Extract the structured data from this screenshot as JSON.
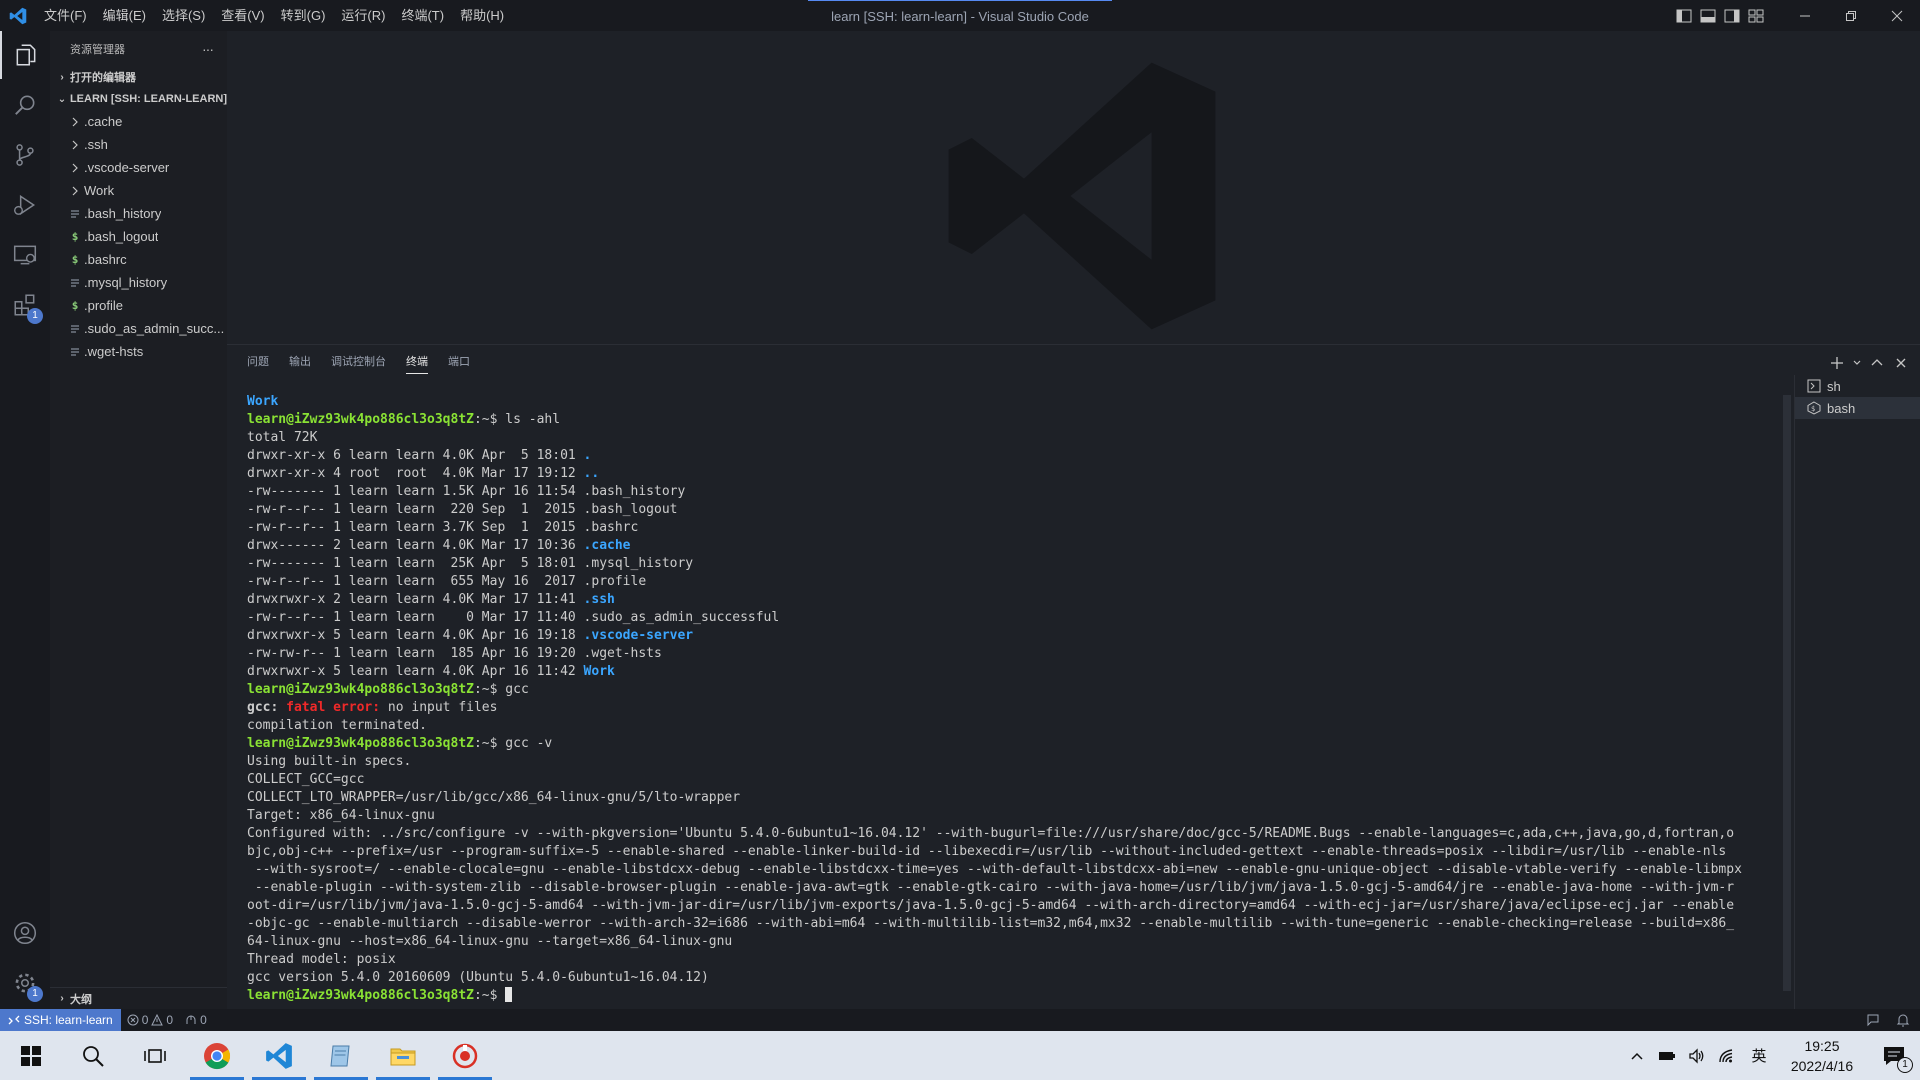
{
  "window": {
    "title": "learn [SSH: learn-learn] - Visual Studio Code",
    "menu": [
      "文件(F)",
      "编辑(E)",
      "选择(S)",
      "查看(V)",
      "转到(G)",
      "运行(R)",
      "终端(T)",
      "帮助(H)"
    ]
  },
  "activitybar": {
    "extensions_badge": "1",
    "settings_badge": "1"
  },
  "sidebar": {
    "title": "资源管理器",
    "more": "···",
    "open_editors": "打开的编辑器",
    "workspace": "LEARN [SSH: LEARN-LEARN]",
    "items": [
      {
        "label": ".cache",
        "kind": "folder"
      },
      {
        "label": ".ssh",
        "kind": "folder"
      },
      {
        "label": ".vscode-server",
        "kind": "folder"
      },
      {
        "label": "Work",
        "kind": "folder"
      },
      {
        "label": ".bash_history",
        "kind": "text"
      },
      {
        "label": ".bash_logout",
        "kind": "shell"
      },
      {
        "label": ".bashrc",
        "kind": "shell"
      },
      {
        "label": ".mysql_history",
        "kind": "text"
      },
      {
        "label": ".profile",
        "kind": "shell"
      },
      {
        "label": ".sudo_as_admin_succ...",
        "kind": "text"
      },
      {
        "label": ".wget-hsts",
        "kind": "text"
      }
    ],
    "outline": "大纲"
  },
  "panel": {
    "tabs": [
      "问题",
      "输出",
      "调试控制台",
      "终端",
      "端口"
    ],
    "active_tab": 3,
    "terminals": [
      "sh",
      "bash"
    ]
  },
  "terminal": {
    "prompt": "learn@iZwz93wk4po886cl3o3q8tZ",
    "lines": [
      [
        {
          "t": "Work",
          "c": "dir"
        }
      ],
      [
        {
          "t": "learn@iZwz93wk4po886cl3o3q8tZ",
          "c": "prompt"
        },
        {
          "t": ":~$ ls -ahl"
        }
      ],
      [
        {
          "t": "total 72K"
        }
      ],
      [
        {
          "t": "drwxr-xr-x 6 learn learn 4.0K Apr  5 18:01 "
        },
        {
          "t": ".",
          "c": "dir"
        }
      ],
      [
        {
          "t": "drwxr-xr-x 4 root  root  4.0K Mar 17 19:12 "
        },
        {
          "t": "..",
          "c": "dir"
        }
      ],
      [
        {
          "t": "-rw------- 1 learn learn 1.5K Apr 16 11:54 .bash_history"
        }
      ],
      [
        {
          "t": "-rw-r--r-- 1 learn learn  220 Sep  1  2015 .bash_logout"
        }
      ],
      [
        {
          "t": "-rw-r--r-- 1 learn learn 3.7K Sep  1  2015 .bashrc"
        }
      ],
      [
        {
          "t": "drwx------ 2 learn learn 4.0K Mar 17 10:36 "
        },
        {
          "t": ".cache",
          "c": "dir"
        }
      ],
      [
        {
          "t": "-rw------- 1 learn learn  25K Apr  5 18:01 .mysql_history"
        }
      ],
      [
        {
          "t": "-rw-r--r-- 1 learn learn  655 May 16  2017 .profile"
        }
      ],
      [
        {
          "t": "drwxrwxr-x 2 learn learn 4.0K Mar 17 11:41 "
        },
        {
          "t": ".ssh",
          "c": "dir"
        }
      ],
      [
        {
          "t": "-rw-r--r-- 1 learn learn    0 Mar 17 11:40 .sudo_as_admin_successful"
        }
      ],
      [
        {
          "t": "drwxrwxr-x 5 learn learn 4.0K Apr 16 19:18 "
        },
        {
          "t": ".vscode-server",
          "c": "dir"
        }
      ],
      [
        {
          "t": "-rw-rw-r-- 1 learn learn  185 Apr 16 19:20 .wget-hsts"
        }
      ],
      [
        {
          "t": "drwxrwxr-x 5 learn learn 4.0K Apr 16 11:42 "
        },
        {
          "t": "Work",
          "c": "dir"
        }
      ],
      [
        {
          "t": "learn@iZwz93wk4po886cl3o3q8tZ",
          "c": "prompt"
        },
        {
          "t": ":~$ gcc"
        }
      ],
      [
        {
          "t": "gcc: ",
          "c": "bold"
        },
        {
          "t": "fatal error: ",
          "c": "err"
        },
        {
          "t": "no input files"
        }
      ],
      [
        {
          "t": "compilation terminated."
        }
      ],
      [
        {
          "t": "learn@iZwz93wk4po886cl3o3q8tZ",
          "c": "prompt"
        },
        {
          "t": ":~$ gcc -v"
        }
      ],
      [
        {
          "t": "Using built-in specs."
        }
      ],
      [
        {
          "t": "COLLECT_GCC=gcc"
        }
      ],
      [
        {
          "t": "COLLECT_LTO_WRAPPER=/usr/lib/gcc/x86_64-linux-gnu/5/lto-wrapper"
        }
      ],
      [
        {
          "t": "Target: x86_64-linux-gnu"
        }
      ],
      [
        {
          "t": "Configured with: ../src/configure -v --with-pkgversion='Ubuntu 5.4.0-6ubuntu1~16.04.12' --with-bugurl=file:///usr/share/doc/gcc-5/README.Bugs --enable-languages=c,ada,c++,java,go,d,fortran,o"
        }
      ],
      [
        {
          "t": "bjc,obj-c++ --prefix=/usr --program-suffix=-5 --enable-shared --enable-linker-build-id --libexecdir=/usr/lib --without-included-gettext --enable-threads=posix --libdir=/usr/lib --enable-nls"
        }
      ],
      [
        {
          "t": " --with-sysroot=/ --enable-clocale=gnu --enable-libstdcxx-debug --enable-libstdcxx-time=yes --with-default-libstdcxx-abi=new --enable-gnu-unique-object --disable-vtable-verify --enable-libmpx"
        }
      ],
      [
        {
          "t": " --enable-plugin --with-system-zlib --disable-browser-plugin --enable-java-awt=gtk --enable-gtk-cairo --with-java-home=/usr/lib/jvm/java-1.5.0-gcj-5-amd64/jre --enable-java-home --with-jvm-r"
        }
      ],
      [
        {
          "t": "oot-dir=/usr/lib/jvm/java-1.5.0-gcj-5-amd64 --with-jvm-jar-dir=/usr/lib/jvm-exports/java-1.5.0-gcj-5-amd64 --with-arch-directory=amd64 --with-ecj-jar=/usr/share/java/eclipse-ecj.jar --enable"
        }
      ],
      [
        {
          "t": "-objc-gc --enable-multiarch --disable-werror --with-arch-32=i686 --with-abi=m64 --with-multilib-list=m32,m64,mx32 --enable-multilib --with-tune=generic --enable-checking=release --build=x86_"
        }
      ],
      [
        {
          "t": "64-linux-gnu --host=x86_64-linux-gnu --target=x86_64-linux-gnu"
        }
      ],
      [
        {
          "t": "Thread model: posix"
        }
      ],
      [
        {
          "t": "gcc version 5.4.0 20160609 (Ubuntu 5.4.0-6ubuntu1~16.04.12)"
        }
      ],
      [
        {
          "t": "learn@iZwz93wk4po886cl3o3q8tZ",
          "c": "prompt"
        },
        {
          "t": ":~$ "
        },
        {
          "t": "",
          "c": "cursor"
        }
      ]
    ]
  },
  "statusbar": {
    "remote": "SSH: learn-learn",
    "errors": "0",
    "warnings": "0",
    "ports": "0"
  },
  "taskbar": {
    "time": "19:25",
    "date": "2022/4/16",
    "ime": "英",
    "notifications": "1"
  }
}
